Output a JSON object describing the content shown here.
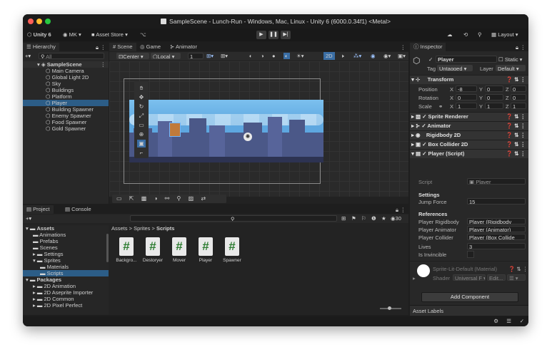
{
  "window": {
    "title": "SampleScene - Lunch-Run - Windows, Mac, Linux - Unity 6 (6000.0.34f1) <Metal>"
  },
  "toolbar": {
    "unity_label": "Unity 6",
    "account": "MK",
    "asset_store": "Asset Store",
    "layout": "Layout"
  },
  "hierarchy": {
    "tab": "Hierarchy",
    "search_placeholder": "All",
    "scene": "SampleScene",
    "items": [
      "Main Camera",
      "Global Light 2D",
      "Sky",
      "Buildings",
      "Platform",
      "Player",
      "Building Spawner",
      "Enemy Spawner",
      "Food Spawner",
      "Gold Spawner"
    ],
    "selected": "Player"
  },
  "scene_view": {
    "tabs": [
      "Scene",
      "Game",
      "Animator"
    ],
    "pivot": "Center",
    "space": "Local",
    "grid_size": "1",
    "mode_2d": "2D"
  },
  "project": {
    "tabs": [
      "Project",
      "Console"
    ],
    "tree": [
      {
        "label": "Assets",
        "level": 0,
        "open": true
      },
      {
        "label": "Animations",
        "level": 1
      },
      {
        "label": "Prefabs",
        "level": 1
      },
      {
        "label": "Scenes",
        "level": 1
      },
      {
        "label": "Settings",
        "level": 1
      },
      {
        "label": "Sprites",
        "level": 1,
        "open": true
      },
      {
        "label": "Materials",
        "level": 2
      },
      {
        "label": "Scripts",
        "level": 2,
        "selected": true
      },
      {
        "label": "Packages",
        "level": 0,
        "open": true
      },
      {
        "label": "2D Animation",
        "level": 1
      },
      {
        "label": "2D Aseprite Importer",
        "level": 1
      },
      {
        "label": "2D Common",
        "level": 1
      },
      {
        "label": "2D Pixel Perfect",
        "level": 1
      }
    ],
    "breadcrumb": [
      "Assets",
      "Sprites",
      "Scripts"
    ],
    "count": "30",
    "files": [
      "Backgro...",
      "Destoryer",
      "Mover",
      "Player",
      "Spawner"
    ]
  },
  "inspector": {
    "tab": "Inspector",
    "object_name": "Player",
    "static_label": "Static",
    "tag_label": "Tag",
    "tag": "Untagged",
    "layer_label": "Layer",
    "layer": "Default",
    "transform": {
      "title": "Transform",
      "position_label": "Position",
      "position": [
        "-8",
        "0",
        "0"
      ],
      "rotation_label": "Rotation",
      "rotation": [
        "0",
        "0",
        "0"
      ],
      "scale_label": "Scale",
      "scale": [
        "1",
        "1",
        "1"
      ]
    },
    "components": [
      "Sprite Renderer",
      "Animator",
      "Rigidbody 2D",
      "Box Collider 2D",
      "Player (Script)"
    ],
    "script_label": "Script",
    "script_value": "Player",
    "settings_header": "Settings",
    "jump_force_label": "Jump Force",
    "jump_force": "15",
    "references_header": "References",
    "refs": [
      {
        "label": "Player Rigidbody",
        "value": "Player (Rigidbody"
      },
      {
        "label": "Player Animator",
        "value": "Player (Animator)"
      },
      {
        "label": "Player Collider",
        "value": "Player (Box Collide"
      }
    ],
    "lives_label": "Lives",
    "lives": "3",
    "invincible_label": "Is Invincible",
    "material": "Sprite-Lit-Default (Material)",
    "shader_label": "Shader",
    "shader": "Universal F",
    "edit_label": "Edit...",
    "add_component": "Add Component",
    "asset_labels": "Asset Labels"
  },
  "colors": {
    "selection": "#2c5d87",
    "sky": "#5ea7e0",
    "buildings": "#4b5888",
    "accent_blue": "#3a6ea5"
  }
}
